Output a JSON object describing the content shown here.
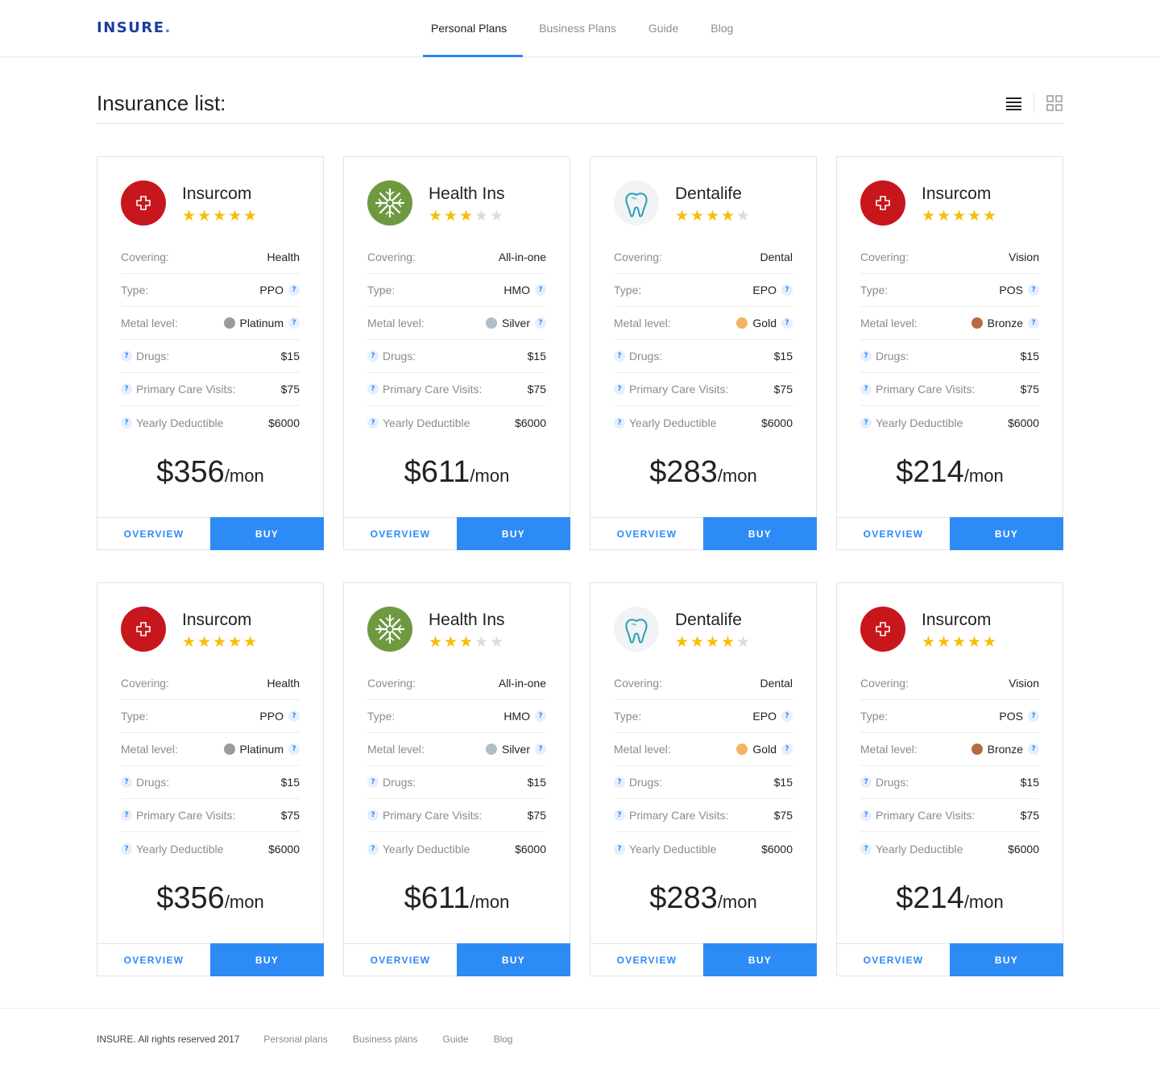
{
  "brand": {
    "name": "INSURE",
    "dot": "."
  },
  "nav": [
    {
      "label": "Personal Plans",
      "active": true
    },
    {
      "label": "Business Plans",
      "active": false
    },
    {
      "label": "Guide",
      "active": false
    },
    {
      "label": "Blog",
      "active": false
    }
  ],
  "page_title": "Insurance list:",
  "view_icons": [
    "list-view-icon",
    "grid-view-icon"
  ],
  "labels": {
    "covering": "Covering:",
    "type": "Type:",
    "metal": "Metal level:",
    "drugs": "Drugs:",
    "primary": "Primary Care Visits:",
    "deductible": "Yearly Deductible",
    "per": "/mon",
    "overview": "OVERVIEW",
    "buy": "BUY",
    "help": "?"
  },
  "colors": {
    "accent": "#2b8af8",
    "brand": "#1a3f9e",
    "star": "#f6be0b",
    "platinum": "#9b9b9b",
    "silver": "#b0bec5",
    "gold": "#f2b462",
    "bronze": "#b56a46"
  },
  "cards": [
    {
      "name": "Insurcom",
      "logo": "red-cross-logo",
      "rating": 5,
      "covering": "Health",
      "type": "PPO",
      "metal": "Platinum",
      "metal_color": "#9b9b9b",
      "drugs": "$15",
      "primary": "$75",
      "deductible": "$6000",
      "price": "$356"
    },
    {
      "name": "Health Ins",
      "logo": "green-snowflake-logo",
      "rating": 3,
      "covering": "All-in-one",
      "type": "HMO",
      "metal": "Silver",
      "metal_color": "#b0bec5",
      "drugs": "$15",
      "primary": "$75",
      "deductible": "$6000",
      "price": "$611"
    },
    {
      "name": "Dentalife",
      "logo": "tooth-logo",
      "rating": 4,
      "covering": "Dental",
      "type": "EPO",
      "metal": "Gold",
      "metal_color": "#f2b462",
      "drugs": "$15",
      "primary": "$75",
      "deductible": "$6000",
      "price": "$283"
    },
    {
      "name": "Insurcom",
      "logo": "red-cross-logo",
      "rating": 5,
      "covering": "Vision",
      "type": "POS",
      "metal": "Bronze",
      "metal_color": "#b56a46",
      "drugs": "$15",
      "primary": "$75",
      "deductible": "$6000",
      "price": "$214"
    },
    {
      "name": "Insurcom",
      "logo": "red-cross-logo",
      "rating": 5,
      "covering": "Health",
      "type": "PPO",
      "metal": "Platinum",
      "metal_color": "#9b9b9b",
      "drugs": "$15",
      "primary": "$75",
      "deductible": "$6000",
      "price": "$356"
    },
    {
      "name": "Health Ins",
      "logo": "green-snowflake-logo",
      "rating": 3,
      "covering": "All-in-one",
      "type": "HMO",
      "metal": "Silver",
      "metal_color": "#b0bec5",
      "drugs": "$15",
      "primary": "$75",
      "deductible": "$6000",
      "price": "$611"
    },
    {
      "name": "Dentalife",
      "logo": "tooth-logo",
      "rating": 4,
      "covering": "Dental",
      "type": "EPO",
      "metal": "Gold",
      "metal_color": "#f2b462",
      "drugs": "$15",
      "primary": "$75",
      "deductible": "$6000",
      "price": "$283"
    },
    {
      "name": "Insurcom",
      "logo": "red-cross-logo",
      "rating": 5,
      "covering": "Vision",
      "type": "POS",
      "metal": "Bronze",
      "metal_color": "#b56a46",
      "drugs": "$15",
      "primary": "$75",
      "deductible": "$6000",
      "price": "$214"
    }
  ],
  "footer": {
    "copyright": "INSURE. All rights reserved 2017",
    "links": [
      "Personal plans",
      "Business plans",
      "Guide",
      "Blog"
    ]
  }
}
